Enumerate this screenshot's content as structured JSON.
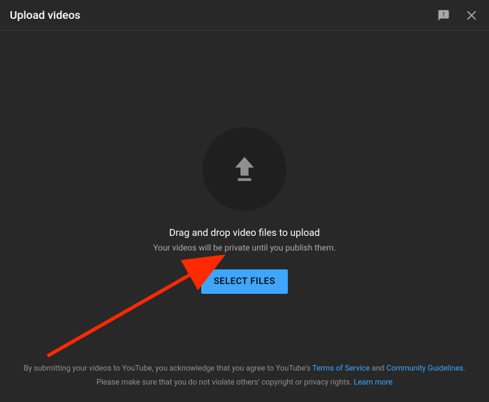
{
  "header": {
    "title": "Upload videos"
  },
  "main": {
    "primary_text": "Drag and drop video files to upload",
    "secondary_text": "Your videos will be private until you publish them.",
    "select_button": "SELECT FILES"
  },
  "footer": {
    "line1_part1": "By submitting your videos to YouTube, you acknowledge that you agree to YouTube's ",
    "terms_link": "Terms of Service",
    "line1_part2": " and ",
    "guidelines_link": "Community Guidelines",
    "line1_part3": ".",
    "line2_part1": "Please make sure that you do not violate others' copyright or privacy rights. ",
    "learn_more_link": "Learn more"
  }
}
